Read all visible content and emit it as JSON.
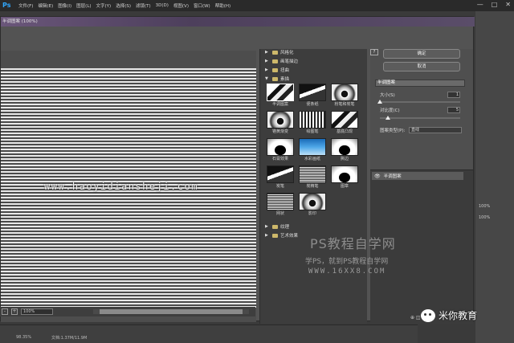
{
  "menubar": {
    "logo": "Ps",
    "items": [
      "文件(F)",
      "编辑(E)",
      "图像(I)",
      "图层(L)",
      "文字(Y)",
      "选择(S)",
      "滤镜(T)",
      "3D(D)",
      "视图(V)",
      "窗口(W)",
      "帮助(H)"
    ],
    "controls": [
      "—",
      "□",
      "✕"
    ]
  },
  "dialog": {
    "title": "半调图案 (100%)",
    "watermark_url": "www.haoyidiansheji.com",
    "zoom_minus": "-",
    "zoom_plus": "+",
    "zoom_value": "100%"
  },
  "gallery": {
    "folders_top": [
      "风格化",
      "画笔描边",
      "扭曲",
      "素描"
    ],
    "thumbnails": [
      {
        "label": "半调图案",
        "selected": true
      },
      {
        "label": "便条纸"
      },
      {
        "label": "粉笔和炭笔"
      },
      {
        "label": "铬黄渐变"
      },
      {
        "label": "绘图笔"
      },
      {
        "label": "基底凸现"
      },
      {
        "label": "石膏效果"
      },
      {
        "label": "水彩画纸"
      },
      {
        "label": "撕边"
      },
      {
        "label": "炭笔"
      },
      {
        "label": "炭精笔"
      },
      {
        "label": "图章"
      },
      {
        "label": "网状"
      },
      {
        "label": "影印"
      }
    ],
    "folders_bottom": [
      "纹理",
      "艺术效果"
    ]
  },
  "settings": {
    "help": "?",
    "ok": "确定",
    "cancel": "取消",
    "filter_name": "半调图案",
    "size_label": "大小(S)",
    "size_value": "1",
    "contrast_label": "对比度(C)",
    "contrast_value": "5",
    "pattern_label": "图案类型(P):",
    "pattern_value": "直线",
    "size_level": 0.0,
    "contrast_level": 0.1
  },
  "layers": {
    "effect_layer": "半调图案",
    "bottom_icons": "⊕ ◫ ▣ ⌂"
  },
  "right_panel": {
    "zoom1": "100%",
    "zoom2": "100%"
  },
  "status": {
    "zoom": "98.35%",
    "doc_info": "文档:1.37M/11.9M"
  },
  "watermark": {
    "main": "PS教程自学网",
    "line1": "学PS，就到PS教程自学网",
    "line2": "WWW.16XX8.COM"
  },
  "wechat": {
    "account": "米你教育"
  }
}
